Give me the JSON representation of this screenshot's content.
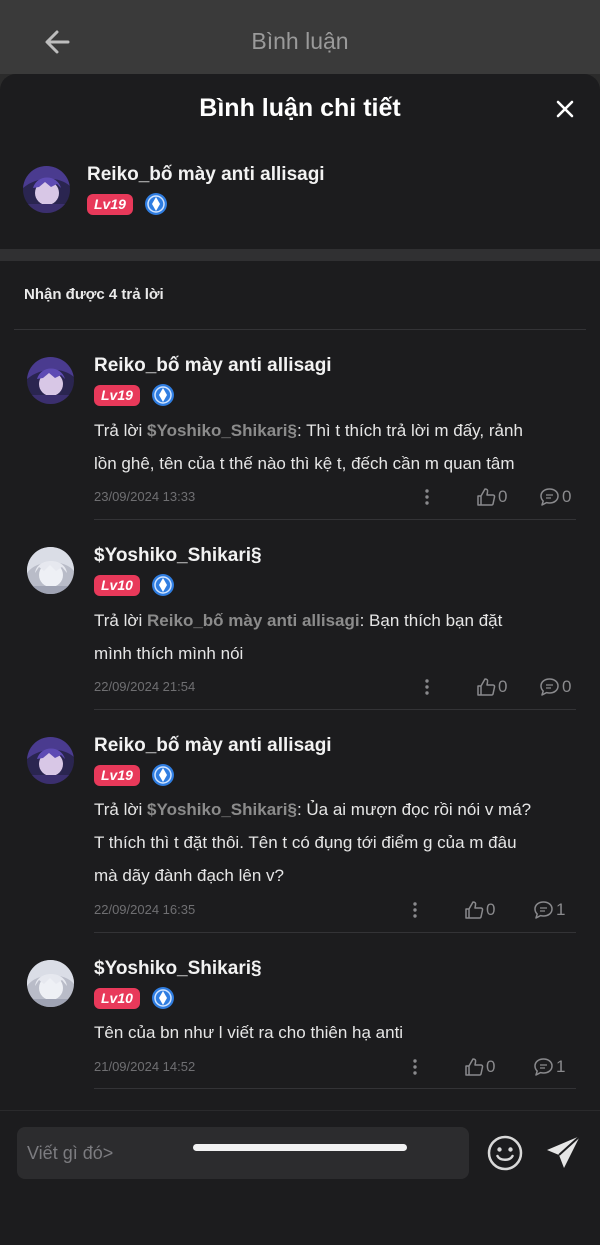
{
  "header": {
    "title": "Bình luận",
    "back_icon": "arrow-left-icon"
  },
  "sheet": {
    "title": "Bình luận chi tiết",
    "close_icon": "close-icon"
  },
  "original_comment": {
    "username": "Reiko_bố mày anti allisagi",
    "level": "Lv19"
  },
  "replies_count_text": "Nhận được 4 trả lời",
  "reply_prefix": "Trả lời ",
  "replies": [
    {
      "username": "Reiko_bố mày anti allisagi",
      "level": "Lv19",
      "reply_to": "$Yoshiko_Shikari§",
      "text_line1": ": Thì t thích trả lời m đấy, rảnh",
      "text_line2": "lồn ghê, tên của t thế nào thì kệ t, đếch cần m quan tâm",
      "timestamp": "23/09/2024 13:33",
      "likes": "0",
      "comments": "0"
    },
    {
      "username": "$Yoshiko_Shikari§",
      "level": "Lv10",
      "reply_to": "Reiko_bố mày anti allisagi",
      "text_line1": ": Bạn thích bạn đặt",
      "text_line2": "mình thích mình nói",
      "timestamp": "22/09/2024 21:54",
      "likes": "0",
      "comments": "0"
    },
    {
      "username": "Reiko_bố mày anti allisagi",
      "level": "Lv19",
      "reply_to": "$Yoshiko_Shikari§",
      "text_line1": ": Ủa ai mượn đọc rồi nói v má?",
      "text_line2": "T thích thì t đặt thôi. Tên t có đụng tới điểm g của m đâu",
      "text_line3": "mà dãy đành đạch lên v?",
      "timestamp": "22/09/2024 16:35",
      "likes": "0",
      "comments": "1"
    },
    {
      "username": "$Yoshiko_Shikari§",
      "level": "Lv10",
      "text_line1": "Tên của bn như l viết ra cho thiên hạ anti",
      "timestamp": "21/09/2024 14:52",
      "likes": "0",
      "comments": "1"
    }
  ],
  "composer": {
    "placeholder": "Viết gì đó>",
    "emoji_icon": "smiley-icon",
    "send_icon": "send-icon"
  },
  "colors": {
    "accent_level": "#e8395a",
    "badge_blue": "#2f7de1",
    "sheet_bg": "#1c1c1e"
  }
}
